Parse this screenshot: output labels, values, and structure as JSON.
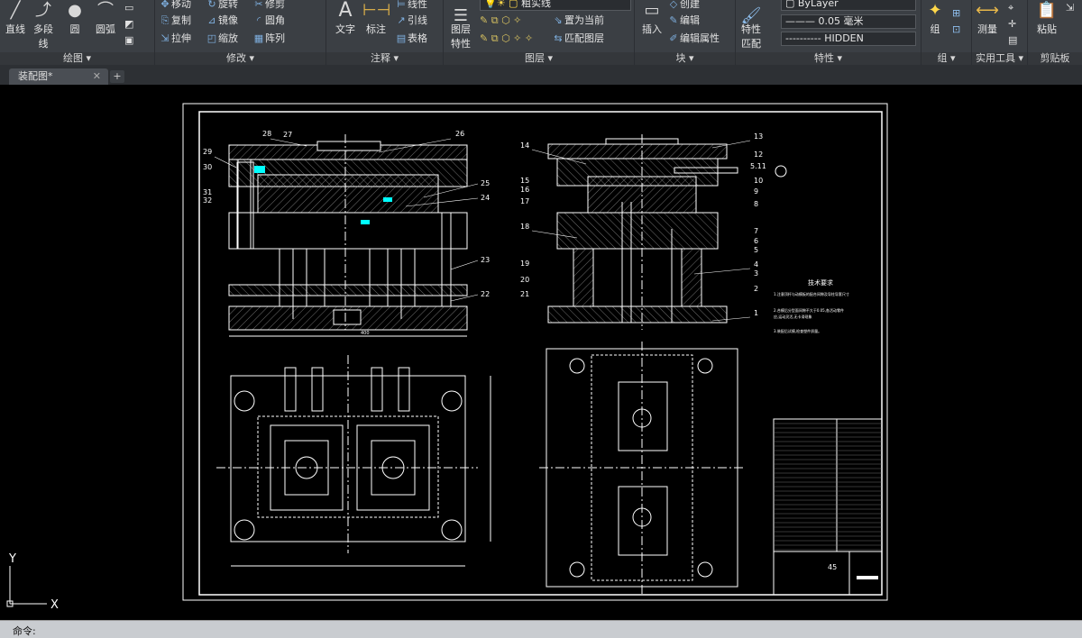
{
  "ribbon": {
    "draw": {
      "line": "直线",
      "polyline": "多段线",
      "circle": "圆",
      "arc": "圆弧",
      "title": "绘图 ▾"
    },
    "modify": {
      "move": "移动",
      "rotate": "旋转",
      "trim": "修剪",
      "copy": "复制",
      "mirror": "镜像",
      "fillet": "圆角",
      "stretch": "拉伸",
      "scale": "缩放",
      "array": "阵列",
      "title": "修改 ▾"
    },
    "annotate": {
      "text": "文字",
      "dimension": "标注",
      "linear": "线性",
      "leader": "引线",
      "table": "表格",
      "title": "注释 ▾"
    },
    "layers": {
      "layer_props": "图层\n特性",
      "layer_name": "粗实线",
      "make_current": "置为当前",
      "match_layer": "匹配图层",
      "title": "图层 ▾"
    },
    "block": {
      "insert": "插入",
      "create": "创建",
      "edit": "编辑",
      "edit_attr": "编辑属性",
      "title": "块 ▾"
    },
    "properties": {
      "match": "特性\n匹配",
      "color": "ByLayer",
      "lineweight": "0.05 毫米",
      "linetype": "HIDDEN",
      "title": "特性 ▾"
    },
    "groups": {
      "group": "组",
      "title": "组 ▾"
    },
    "utilities": {
      "measure": "测量",
      "title": "实用工具 ▾"
    },
    "clipboard": {
      "paste": "粘贴",
      "title": "剪贴板"
    }
  },
  "tabs": [
    {
      "label": "装配图*"
    }
  ],
  "drawing": {
    "tech_title": "技术要求",
    "tech_lines": [
      "1.注意顶杆与动模板的配合间隙及导柱导套尺寸",
      "2.合模后分型面间隙不大于0.05,各活动零件",
      "应,运动灵活,无卡滞现象",
      "3.装配后试模,检查塑件质量。"
    ],
    "leaders_left": [
      "28",
      "27",
      "26",
      "29",
      "30",
      "25",
      "24",
      "31",
      "32",
      "23",
      "22"
    ],
    "leaders_right": [
      "14",
      "13",
      "12",
      "5.11",
      "10",
      "9",
      "15",
      "16",
      "17",
      "8",
      "18",
      "7",
      "6",
      "5",
      "4",
      "19",
      "3",
      "20",
      "21",
      "2",
      "1"
    ],
    "title_block_scale": "45",
    "dim_bottom": "400"
  },
  "ucs": {
    "y": "Y",
    "x": "X"
  },
  "command": {
    "prompt": "命令:"
  }
}
